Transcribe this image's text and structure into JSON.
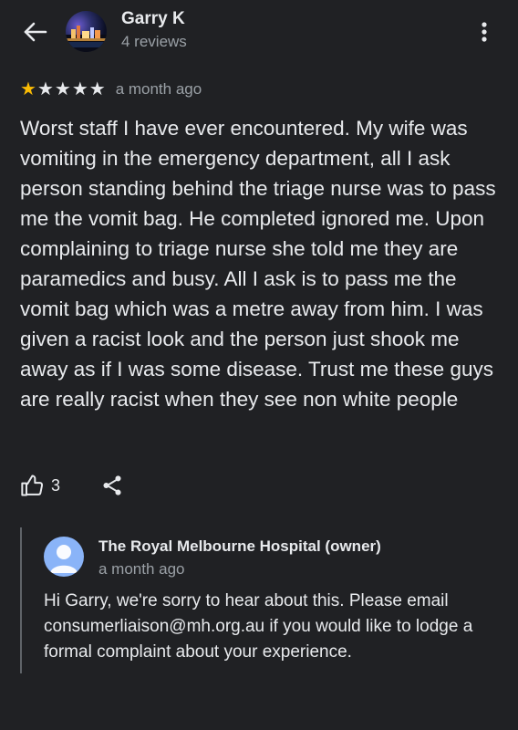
{
  "header": {
    "back_icon": "arrow-back-icon",
    "reviewer_name": "Garry K",
    "reviewer_meta": "4 reviews",
    "more_icon": "more-vert-icon"
  },
  "review": {
    "rating": 1,
    "max_rating": 5,
    "star_color": "#fbbc04",
    "date": "a month ago",
    "text": "Worst staff I have ever encountered. My wife was vomiting in the emergency department, all I ask person standing behind the triage nurse was to pass me the vomit bag. He completed ignored me. Upon complaining to triage nurse she told me they are paramedics and busy. All I ask is to pass me the vomit bag which was a metre away from him. I was given a racist look and the person just shook me away as if I was some disease. Trust me these guys are really racist when they see non white people"
  },
  "actions": {
    "like_icon": "thumbs-up-icon",
    "like_count": "3",
    "share_icon": "share-icon"
  },
  "owner_reply": {
    "avatar_color": "#8ab4f8",
    "name": "The Royal Melbourne Hospital (owner)",
    "date": "a month ago",
    "text": "Hi Garry, we're sorry to hear about this. Please email consumerliaison@mh.org.au if you would like to lodge a formal complaint about your experience."
  }
}
